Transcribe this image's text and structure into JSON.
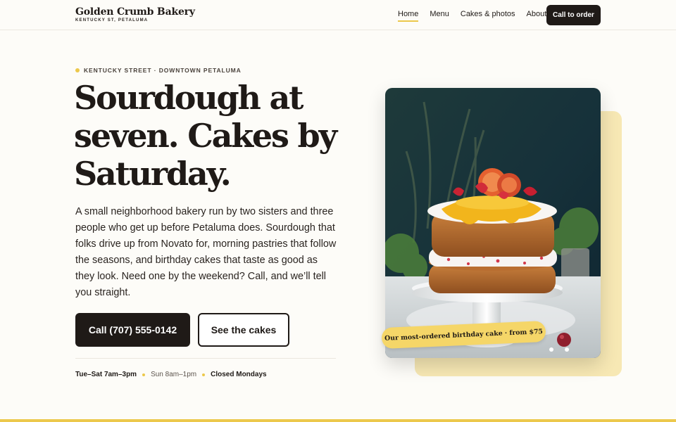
{
  "header": {
    "brand_name": "Golden Crumb Bakery",
    "brand_sub": "KENTUCKY ST, PETALUMA",
    "nav": [
      {
        "label": "Home",
        "active": true
      },
      {
        "label": "Menu",
        "active": false
      },
      {
        "label": "Cakes & photos",
        "active": false
      },
      {
        "label": "About",
        "active": false
      }
    ],
    "cta_label": "Call to order"
  },
  "hero": {
    "eyebrow": "KENTUCKY STREET · DOWNTOWN PETALUMA",
    "headline_line1": "Sourdough at",
    "headline_line2": "seven. Cakes by",
    "headline_line3": "Saturday.",
    "intro": "A small neighborhood bakery run by two sisters and three people who get up before Petaluma does. Sourdough that folks drive up from Novato for, morning pastries that follow the seasons, and birthday cakes that taste as good as they look. Need one by the weekend? Call, and we’ll tell you straight.",
    "primary_button": "Call (707) 555-0142",
    "secondary_button": "See the cakes",
    "hours": {
      "weekday": "Tue–Sat 7am–3pm",
      "sunday": "Sun 8am–1pm",
      "closed": "Closed Mondays"
    },
    "photo_caption": "Our most-ordered birthday cake · from $75"
  },
  "colors": {
    "accent": "#ecc84c",
    "ink": "#1f1a17",
    "background": "#fdfcf8"
  }
}
